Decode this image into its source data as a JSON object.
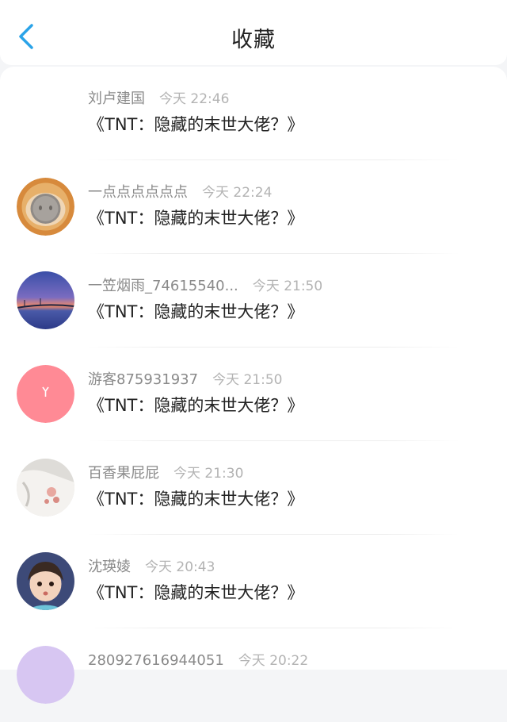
{
  "header": {
    "back_icon": "chevron-left-icon",
    "title": "收藏",
    "accent_color": "#2aa3e8"
  },
  "items": [
    {
      "name": "刘卢建国",
      "time": "今天 22:46",
      "message": "《TNT：隐藏的末世大佬？》",
      "avatar": "none"
    },
    {
      "name": "一点点点点点点",
      "time": "今天 22:24",
      "message": "《TNT：隐藏的末世大佬？》",
      "avatar": "pig-nose-photo"
    },
    {
      "name": "一笠烟雨_74615540...",
      "time": "今天 21:50",
      "message": "《TNT：隐藏的末世大佬？》",
      "avatar": "sunset-bridge-photo"
    },
    {
      "name": "游客875931937",
      "time": "今天 21:50",
      "message": "《TNT：隐藏的末世大佬？》",
      "avatar": "pink-default-avatar"
    },
    {
      "name": "百香果屁屁",
      "time": "今天 21:30",
      "message": "《TNT：隐藏的末世大佬？》",
      "avatar": "white-shirt-photo"
    },
    {
      "name": "沈瑛婈",
      "time": "今天 20:43",
      "message": "《TNT：隐藏的末世大佬？》",
      "avatar": "child-photo"
    },
    {
      "name": "280927616944051",
      "time": "今天 20:22",
      "message": "",
      "avatar": "lavender-avatar"
    }
  ]
}
